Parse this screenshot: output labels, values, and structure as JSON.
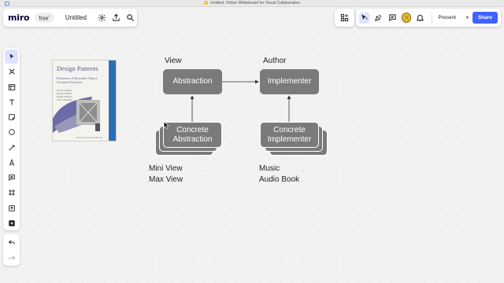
{
  "window": {
    "title": "Untitled, Online Whiteboard for Visual Collaboration"
  },
  "header": {
    "logo": "miro",
    "plan_badge": "free",
    "board_name": "Untitled",
    "present_label": "Present",
    "share_label": "Share",
    "accent_color": "#4262ff"
  },
  "toolbar": {
    "tools": [
      "select-tool",
      "frames-templates-tool",
      "table-tool",
      "text-tool",
      "sticky-note-tool",
      "shape-tool",
      "connection-line-tool",
      "pen-tool",
      "comment-tool",
      "frame-tool",
      "upload-tool",
      "add-more-tool"
    ],
    "undo": "undo-icon",
    "redo": "redo-icon"
  },
  "book": {
    "title": "Design Patterns",
    "subtitle": "Elements of Reusable Object-Oriented Software",
    "authors": "Erich Gamma\nRichard Helm\nRalph Johnson\nJohn Vlissides",
    "foreword": "Foreword by Grady Booch"
  },
  "diagram": {
    "left_heading": "View",
    "right_heading": "Author",
    "abstraction": "Abstraction",
    "implementer": "Implementer",
    "concrete_abstraction_line1": "Concrete",
    "concrete_abstraction_line2": "Abstraction",
    "concrete_implementer_line1": "Concrete",
    "concrete_implementer_line2": "Implementer",
    "left_examples": [
      "Mini View",
      "Max View"
    ],
    "right_examples": [
      "Music",
      "Audio Book"
    ],
    "box_color": "#7a7a7a"
  }
}
